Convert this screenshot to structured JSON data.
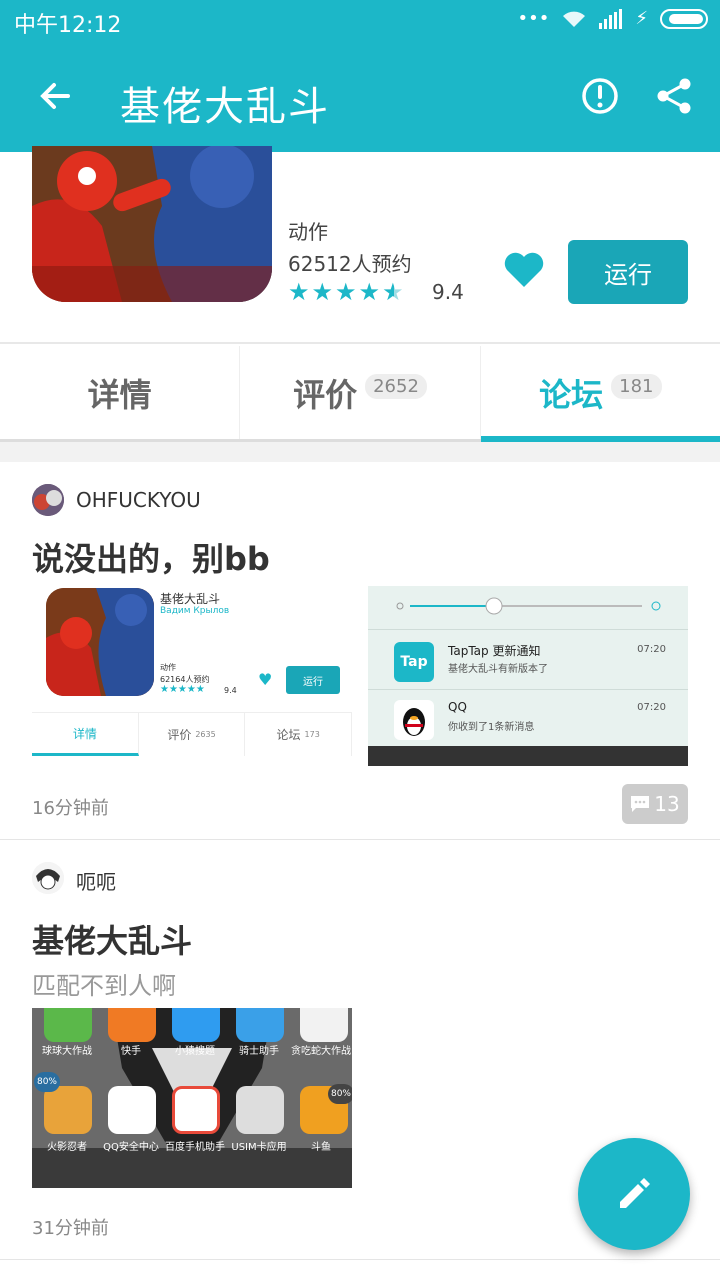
{
  "status_bar": {
    "time": "中午12:12"
  },
  "app_bar": {
    "title": "基佬大乱斗"
  },
  "game": {
    "genre": "动作",
    "reservations": "62512人预约",
    "rating": "9.4",
    "run_label": "运行",
    "star_count": 4.5
  },
  "tabs": [
    {
      "label": "详情",
      "count": ""
    },
    {
      "label": "评价",
      "count": "2652"
    },
    {
      "label": "论坛",
      "count": "181"
    }
  ],
  "posts": [
    {
      "username": "OHFUCKYOU",
      "title": "说没出的，别bb",
      "time": "16分钟前",
      "comments": "13",
      "shot1": {
        "game": "基佬大乱斗",
        "dev": "Вадим Крылов",
        "genre": "动作",
        "reserve": "62164人预约",
        "rating": "9.4",
        "run": "运行",
        "tab1": "详情",
        "tab2": "评价",
        "tab2_count": "2635",
        "tab3": "论坛",
        "tab3_count": "173"
      },
      "shot2": {
        "n1_title": "TapTap 更新通知",
        "n1_sub": "基佬大乱斗有新版本了",
        "n1_time": "07:20",
        "n1_icon": "Tap",
        "n2_title": "QQ",
        "n2_sub": "你收到了1条新消息",
        "n2_time": "07:20"
      }
    },
    {
      "username": "呃呃",
      "title": "基佬大乱斗",
      "body": "匹配不到人啊",
      "time": "31分钟前",
      "shot3": {
        "a1": "球球大作战",
        "a2": "快手",
        "a3": "小猿搜题",
        "a4": "骑士助手",
        "a5": "贪吃蛇大作战",
        "b1": "火影忍者",
        "b2": "QQ安全中心",
        "b3": "百度手机助手",
        "b4": "USIM卡应用",
        "b5": "斗鱼",
        "badge1": "80%",
        "badge5": "80%"
      }
    }
  ],
  "colors": {
    "accent": "#1cb7c8",
    "run_button": "#1aa6b7"
  }
}
